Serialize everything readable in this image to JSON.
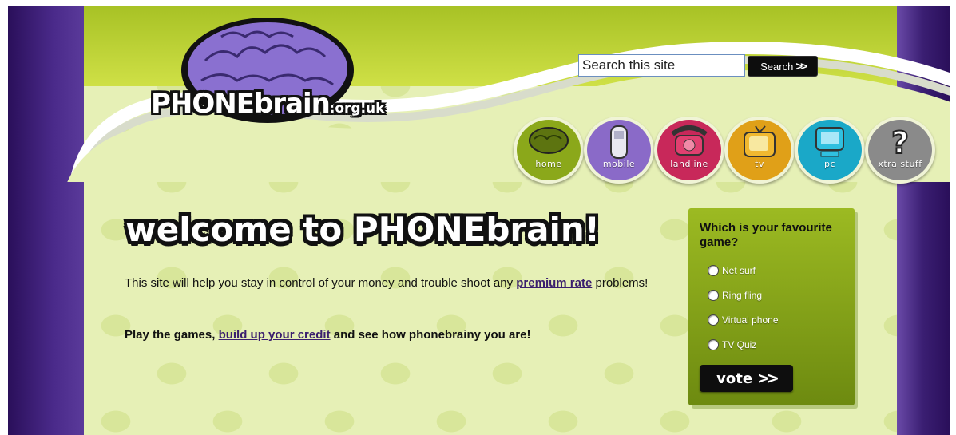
{
  "site": {
    "logo_main": "PHONEbrain",
    "logo_suffix": ".org.uk"
  },
  "search": {
    "placeholder": "Search this site",
    "value": "Search this site",
    "button_label": "Search"
  },
  "nav": {
    "items": [
      {
        "label": "home",
        "color": "#8ba81a",
        "icon": "brain-icon"
      },
      {
        "label": "mobile",
        "color": "#8a6ac8",
        "icon": "mobile-phone-icon"
      },
      {
        "label": "landline",
        "color": "#c8285a",
        "icon": "landline-phone-icon"
      },
      {
        "label": "tv",
        "color": "#e0a018",
        "icon": "tv-icon"
      },
      {
        "label": "pc",
        "color": "#1aa8c8",
        "icon": "pc-icon"
      },
      {
        "label": "xtra stuff",
        "color": "#8a8a8a",
        "icon": "question-mark-icon"
      }
    ]
  },
  "main": {
    "welcome": "welcome to PHONEbrain!",
    "intro_before": "This site will help you stay in control of your money and trouble shoot any ",
    "intro_link": "premium rate",
    "intro_after": " problems!",
    "play_before": "Play the games, ",
    "play_link": "build up your credit",
    "play_after": " and see how phonebrainy you are!"
  },
  "poll": {
    "question": "Which is your favourite game?",
    "options": [
      "Net surf",
      "Ring fling",
      "Virtual phone",
      "TV Quiz"
    ],
    "vote_label": "vote"
  },
  "colors": {
    "purple": "#3a1e6e",
    "green": "#9cba22",
    "background": "#e6f0b6"
  }
}
